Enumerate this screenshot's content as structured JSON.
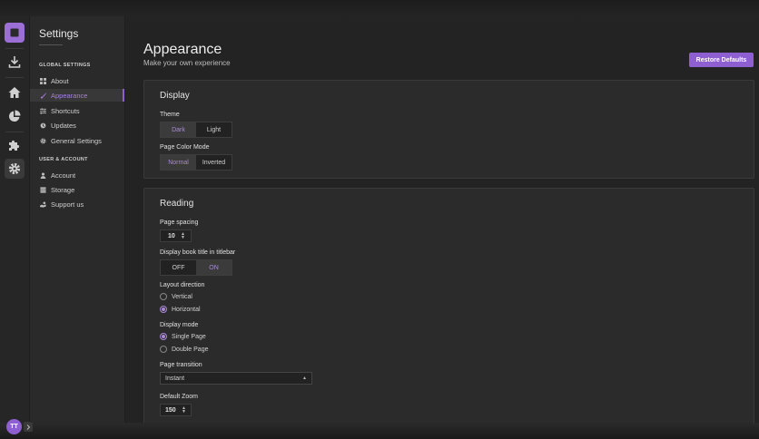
{
  "rail": {
    "icons": [
      "app-logo-icon",
      "download-icon",
      "home-icon",
      "chart-icon",
      "puzzle-icon",
      "gear-icon"
    ],
    "avatar_initials": "TT",
    "accent": "#8e5fd0"
  },
  "sidebar": {
    "title": "Settings",
    "global_section": "GLOBAL SETTINGS",
    "global_items": [
      {
        "label": "About",
        "icon": "grid-icon"
      },
      {
        "label": "Appearance",
        "icon": "brush-icon"
      },
      {
        "label": "Shortcuts",
        "icon": "sliders-icon"
      },
      {
        "label": "Updates",
        "icon": "update-icon"
      },
      {
        "label": "General Settings",
        "icon": "gear-icon"
      }
    ],
    "user_section": "USER & ACCOUNT",
    "user_items": [
      {
        "label": "Account",
        "icon": "user-icon"
      },
      {
        "label": "Storage",
        "icon": "database-icon"
      },
      {
        "label": "Support us",
        "icon": "support-icon"
      }
    ]
  },
  "header": {
    "title": "Appearance",
    "subtitle": "Make your own experience",
    "restore_label": "Restore Defaults"
  },
  "display": {
    "title": "Display",
    "theme_label": "Theme",
    "theme_options": [
      "Dark",
      "Light"
    ],
    "theme_selected": "Dark",
    "color_mode_label": "Page Color Mode",
    "color_mode_options": [
      "Normal",
      "Inverted"
    ],
    "color_mode_selected": "Normal"
  },
  "reading": {
    "title": "Reading",
    "page_spacing_label": "Page spacing",
    "page_spacing_value": "10",
    "titlebar_label": "Display book title in titlebar",
    "titlebar_options": [
      "OFF",
      "ON"
    ],
    "titlebar_selected": "ON",
    "layout_label": "Layout direction",
    "layout_options": [
      "Vertical",
      "Horizontal"
    ],
    "layout_selected": "Horizontal",
    "display_mode_label": "Display mode",
    "display_mode_options": [
      "Single Page",
      "Double Page"
    ],
    "display_mode_selected": "Single Page",
    "transition_label": "Page transition",
    "transition_value": "Instant",
    "zoom_label": "Default Zoom",
    "zoom_value": "150"
  }
}
